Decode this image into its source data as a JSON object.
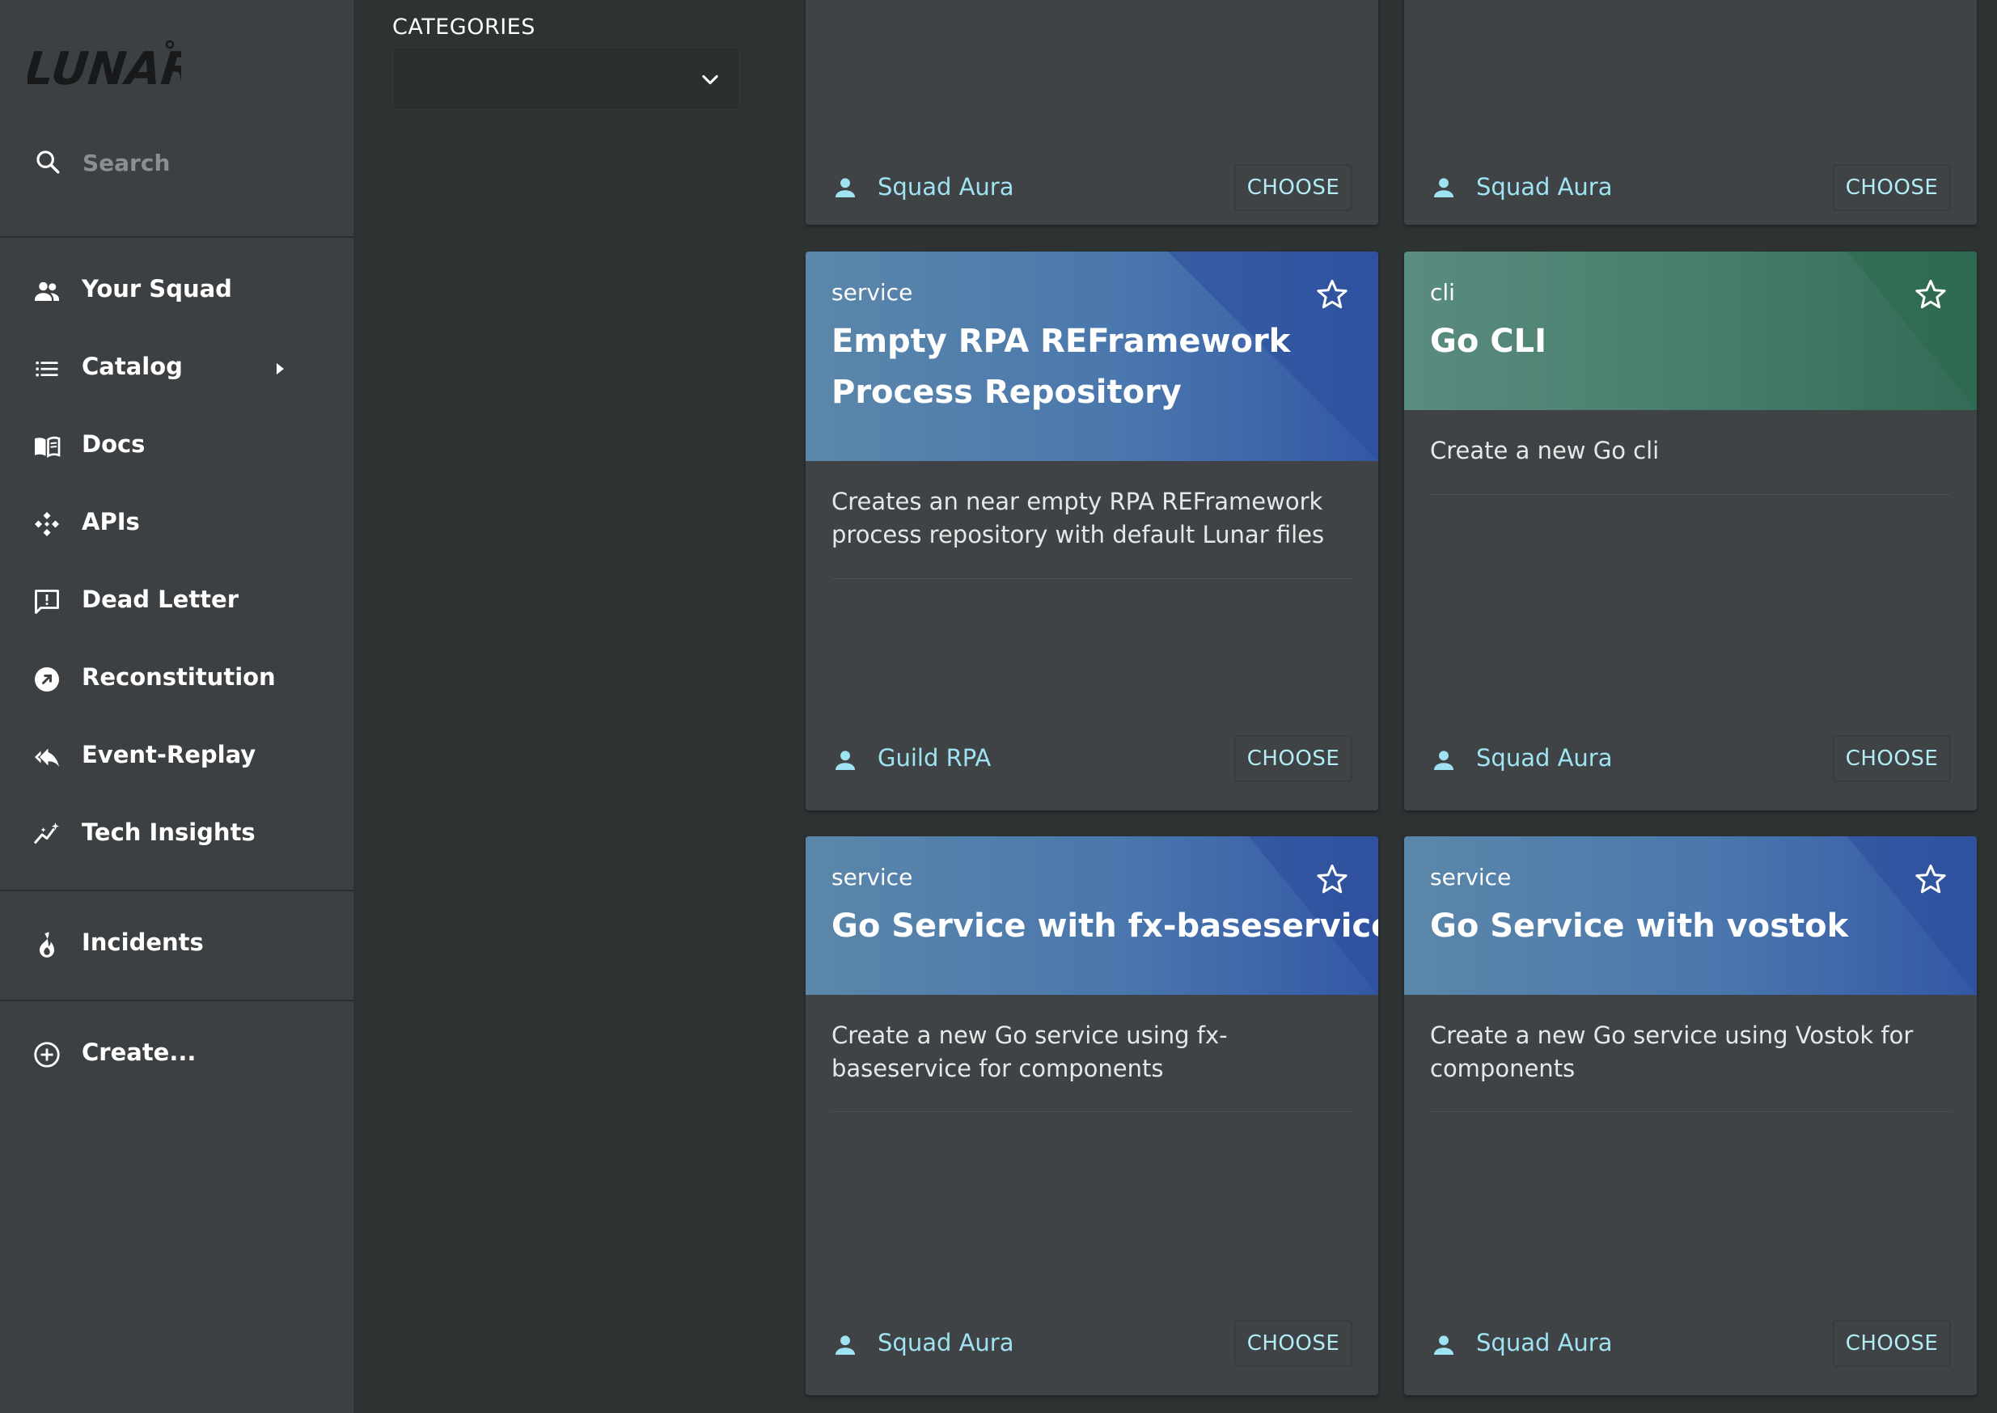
{
  "app": {
    "logo_text": "LUNAR"
  },
  "sidebar": {
    "search_placeholder": "Search",
    "nav": [
      {
        "label": "Your Squad",
        "icon": "people-icon"
      },
      {
        "label": "Catalog",
        "icon": "list-icon"
      },
      {
        "label": "Docs",
        "icon": "book-icon"
      },
      {
        "label": "APIs",
        "icon": "api-icon"
      },
      {
        "label": "Dead Letter",
        "icon": "feedback-icon"
      },
      {
        "label": "Reconstitution",
        "icon": "arrow-circle-icon"
      },
      {
        "label": "Event-Replay",
        "icon": "reply-all-icon"
      },
      {
        "label": "Tech Insights",
        "icon": "insights-icon"
      },
      {
        "label": "Incidents",
        "icon": "fire-icon"
      },
      {
        "label": "Create...",
        "icon": "add-circle-icon"
      }
    ]
  },
  "filters": {
    "categories_label": "CATEGORIES",
    "categories_value": ""
  },
  "cards": [
    {
      "type": "",
      "title": "",
      "description": "",
      "owner": "Squad Aura",
      "action": "CHOOSE"
    },
    {
      "type": "",
      "title": "",
      "description": "",
      "owner": "Squad Aura",
      "action": "CHOOSE"
    },
    {
      "type": "service",
      "title": "Empty RPA REFramework Process Repository",
      "description": "Creates an near empty RPA REFramework process repository with default Lunar files",
      "owner": "Guild RPA",
      "action": "CHOOSE",
      "header_color": "blue"
    },
    {
      "type": "cli",
      "title": "Go CLI",
      "description": "Create a new Go cli",
      "owner": "Squad Aura",
      "action": "CHOOSE",
      "header_color": "green"
    },
    {
      "type": "service",
      "title": "Go Service with fx-baseservice",
      "description": "Create a new Go service using fx-baseservice for components",
      "owner": "Squad Aura",
      "action": "CHOOSE",
      "header_color": "blue"
    },
    {
      "type": "service",
      "title": "Go Service with vostok",
      "description": "Create a new Go service using Vostok for components",
      "owner": "Squad Aura",
      "action": "CHOOSE",
      "header_color": "blue"
    }
  ],
  "colors": {
    "sidebar_bg": "#3c4043",
    "page_bg": "#2d3233",
    "card_bg": "#3f4346",
    "accent_text": "#9fe3f2",
    "header_blue": "#4a77ad",
    "header_green": "#467c6a"
  }
}
